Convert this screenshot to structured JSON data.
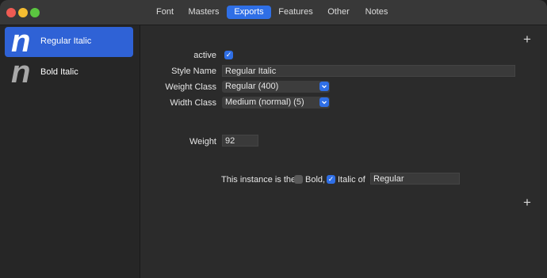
{
  "tabs": [
    {
      "label": "Font",
      "active": false
    },
    {
      "label": "Masters",
      "active": false
    },
    {
      "label": "Exports",
      "active": true
    },
    {
      "label": "Features",
      "active": false
    },
    {
      "label": "Other",
      "active": false
    },
    {
      "label": "Notes",
      "active": false
    }
  ],
  "sidebar": {
    "items": [
      {
        "glyph": "n",
        "label": "Regular Italic",
        "selected": true
      },
      {
        "glyph": "n",
        "label": "Bold Italic",
        "selected": false
      }
    ]
  },
  "form": {
    "active_label": "active",
    "active_checked": true,
    "style_name_label": "Style Name",
    "style_name_value": "Regular Italic",
    "weight_class_label": "Weight Class",
    "weight_class_value": "Regular (400)",
    "width_class_label": "Width Class",
    "width_class_value": "Medium (normal) (5)",
    "weight_label": "Weight",
    "weight_value": "92",
    "instance_prefix": "This instance is the",
    "bold_label": "Bold,",
    "bold_checked": false,
    "italic_label": "Italic of",
    "italic_checked": true,
    "link_value": "Regular"
  },
  "colors": {
    "accent": "#2f6fe6",
    "selection": "#2f62d6"
  }
}
